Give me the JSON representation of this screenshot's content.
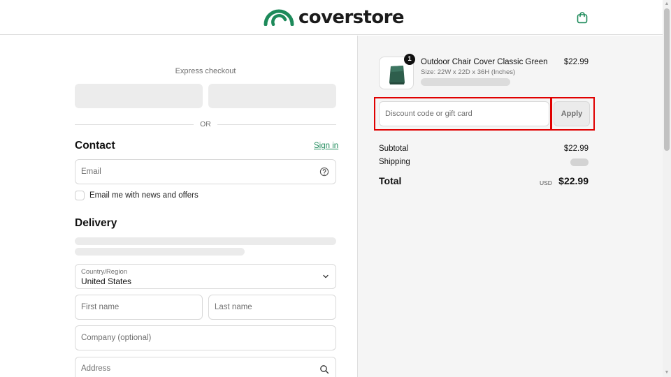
{
  "header": {
    "brand": "coverstore",
    "brand_color": "#1d8a5a",
    "cart_icon": "shopping-bag-icon"
  },
  "express": {
    "label": "Express checkout",
    "divider_text": "OR"
  },
  "contact": {
    "title": "Contact",
    "signin_label": "Sign in",
    "email_placeholder": "Email",
    "email_help_icon": "question-circle-icon",
    "newsletter_label": "Email me with news and offers",
    "newsletter_checked": false
  },
  "delivery": {
    "title": "Delivery",
    "country_label": "Country/Region",
    "country_value": "United States",
    "first_name_placeholder": "First name",
    "last_name_placeholder": "Last name",
    "company_placeholder": "Company (optional)",
    "address_placeholder": "Address",
    "address_icon": "search-icon"
  },
  "summary": {
    "item": {
      "quantity": "1",
      "title": "Outdoor Chair Cover Classic Green",
      "variant": "Size: 22W x 22D x 36H (Inches)",
      "price": "$22.99",
      "image_icon": "chair-cover-thumbnail"
    },
    "discount_placeholder": "Discount code or gift card",
    "apply_label": "Apply",
    "subtotal_label": "Subtotal",
    "subtotal_value": "$22.99",
    "shipping_label": "Shipping",
    "total_label": "Total",
    "currency": "USD",
    "total_value": "$22.99"
  },
  "colors": {
    "accent": "#1d8a5a",
    "highlight": "#e00000",
    "summary_bg": "#f5f5f5"
  }
}
